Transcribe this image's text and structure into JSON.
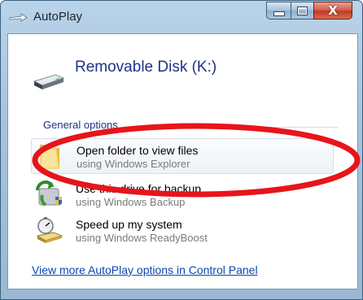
{
  "window": {
    "title": "AutoPlay",
    "icon": "autoplay-arrow-icon",
    "buttons": [
      "minimize-icon",
      "maximize-icon",
      "close-icon"
    ],
    "close_glyph": "X"
  },
  "device": {
    "name": "Removable Disk (K:)",
    "icon": "removable-disk-icon"
  },
  "section": {
    "label": "General options"
  },
  "options": [
    {
      "title": "Open folder to view files",
      "subtitle": "using Windows Explorer",
      "icon": "folder-icon",
      "selected": true
    },
    {
      "title": "Use this drive for backup",
      "subtitle": "using Windows Backup",
      "icon": "backup-icon",
      "selected": false
    },
    {
      "title": "Speed up my system",
      "subtitle": "using Windows ReadyBoost",
      "icon": "readyboost-icon",
      "selected": false
    }
  ],
  "footer": {
    "link": "View more AutoPlay options in Control Panel"
  },
  "colors": {
    "title_blue": "#1e3287",
    "link_blue": "#0a46b0",
    "annotation_red": "#e8141c",
    "close_red": "#c5412a"
  }
}
